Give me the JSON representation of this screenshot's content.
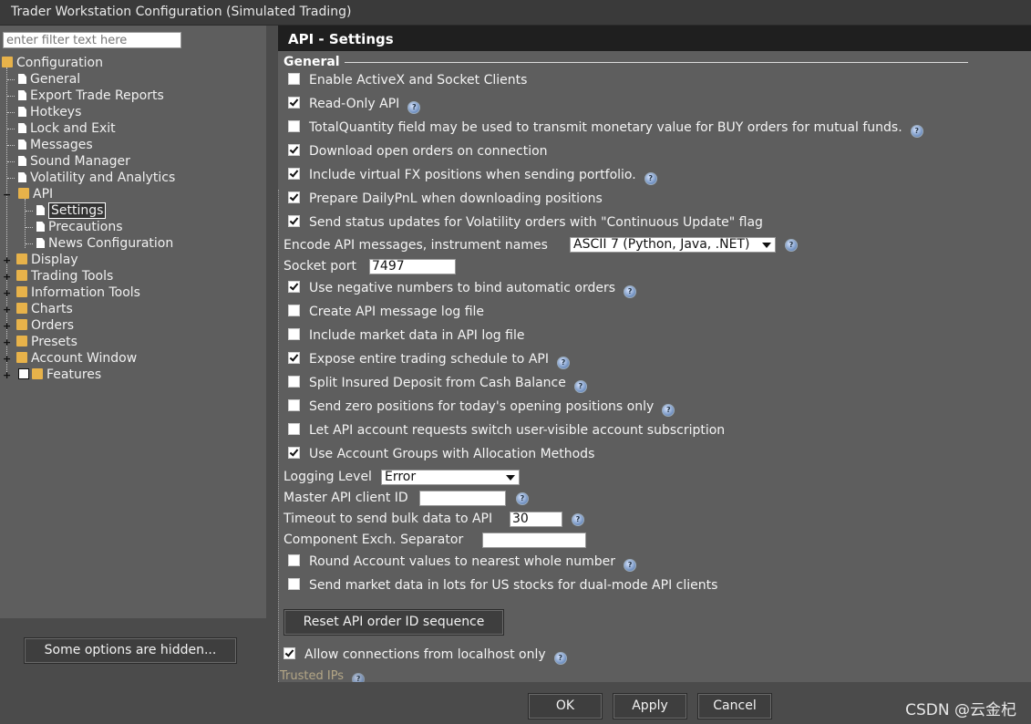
{
  "window": {
    "title": "Trader Workstation Configuration (Simulated Trading)"
  },
  "filter": {
    "placeholder": "enter filter text here"
  },
  "tree": {
    "root": "Configuration",
    "items": [
      "General",
      "Export Trade Reports",
      "Hotkeys",
      "Lock and Exit",
      "Messages",
      "Sound Manager",
      "Volatility and Analytics"
    ],
    "api": "API",
    "api_children": [
      "Settings",
      "Precautions",
      "News Configuration"
    ],
    "groups": [
      "Display",
      "Trading Tools",
      "Information Tools",
      "Charts",
      "Orders",
      "Presets",
      "Account Window"
    ],
    "features": "Features",
    "selected": "Settings"
  },
  "hidden_button": "Some options are hidden...",
  "panel": {
    "header": "API - Settings",
    "group": "General",
    "checks": [
      {
        "label": "Enable ActiveX and Socket Clients",
        "checked": false,
        "help": false
      },
      {
        "label": "Read-Only API",
        "checked": true,
        "help": true
      },
      {
        "label": "TotalQuantity field may be used to transmit monetary value for BUY orders for mutual funds.",
        "checked": false,
        "help": true
      },
      {
        "label": "Download open orders on connection",
        "checked": true,
        "help": false
      },
      {
        "label": "Include virtual FX positions when sending portfolio.",
        "checked": true,
        "help": true
      },
      {
        "label": "Prepare DailyPnL when downloading positions",
        "checked": true,
        "help": false
      },
      {
        "label": "Send status updates for Volatility orders with \"Continuous Update\" flag",
        "checked": true,
        "help": false
      }
    ],
    "encode_label": "Encode API messages, instrument names",
    "encode_value": "ASCII 7 (Python, Java, .NET)",
    "socket_label": "Socket port",
    "socket_value": "7497",
    "checks2": [
      {
        "label": "Use negative numbers to bind automatic orders",
        "checked": true,
        "help": true
      },
      {
        "label": "Create API message log file",
        "checked": false,
        "help": false
      },
      {
        "label": "Include market data in API log file",
        "checked": false,
        "help": false
      },
      {
        "label": "Expose entire trading schedule to API",
        "checked": true,
        "help": true
      },
      {
        "label": "Split Insured Deposit from Cash Balance",
        "checked": false,
        "help": true
      },
      {
        "label": "Send zero positions for today's opening positions only",
        "checked": false,
        "help": true
      },
      {
        "label": "Let API account requests switch user-visible account subscription",
        "checked": false,
        "help": false
      },
      {
        "label": "Use Account Groups with Allocation Methods",
        "checked": true,
        "help": false
      }
    ],
    "logging_label": "Logging Level",
    "logging_value": "Error",
    "master_label": "Master API client ID",
    "master_value": "",
    "timeout_label": "Timeout to send bulk data to API",
    "timeout_value": "30",
    "component_label": "Component Exch. Separator",
    "component_value": "",
    "checks3": [
      {
        "label": "Round Account values to nearest whole number",
        "checked": false,
        "help": true
      },
      {
        "label": "Send market data in lots for US stocks for dual-mode API clients",
        "checked": false,
        "help": false
      }
    ],
    "reset_button": "Reset API order ID sequence",
    "localhost": {
      "label": "Allow connections from localhost only",
      "checked": true
    },
    "trusted": "Trusted IPs"
  },
  "footer": {
    "ok": "OK",
    "apply": "Apply",
    "cancel": "Cancel"
  },
  "watermark": "CSDN @云金杞"
}
